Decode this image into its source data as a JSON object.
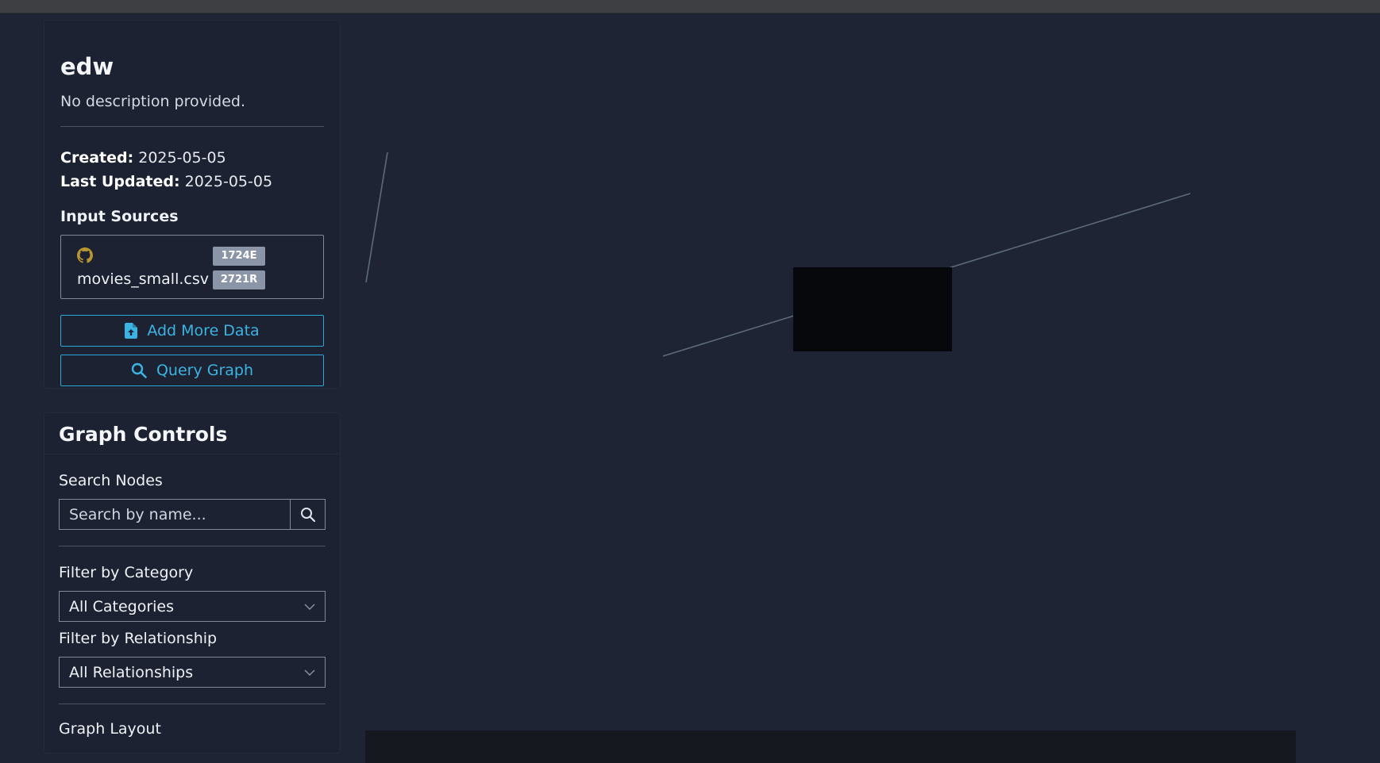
{
  "project": {
    "name": "edw",
    "description": "No description provided.",
    "created_label": "Created:",
    "created_value": "2025-05-05",
    "updated_label": "Last Updated:",
    "updated_value": "2025-05-05"
  },
  "input_sources": {
    "heading": "Input Sources",
    "items": [
      {
        "name": "movies_small.csv",
        "entities_badge": "1724E",
        "relationships_badge": "2721R",
        "icon": "github-icon"
      }
    ]
  },
  "actions": {
    "add_more_data": "Add More Data",
    "query_graph": "Query Graph"
  },
  "graph_controls": {
    "title": "Graph Controls",
    "search_label": "Search Nodes",
    "search_placeholder": "Search by name...",
    "category_label": "Filter by Category",
    "category_value": "All Categories",
    "relationship_label": "Filter by Relationship",
    "relationship_value": "All Relationships",
    "layout_label": "Graph Layout"
  },
  "colors": {
    "background": "#1e2434",
    "accent": "#3bb4e3",
    "badge": "#8b95a8",
    "github_icon": "#b8962e",
    "edge": "#5d6a7a"
  }
}
